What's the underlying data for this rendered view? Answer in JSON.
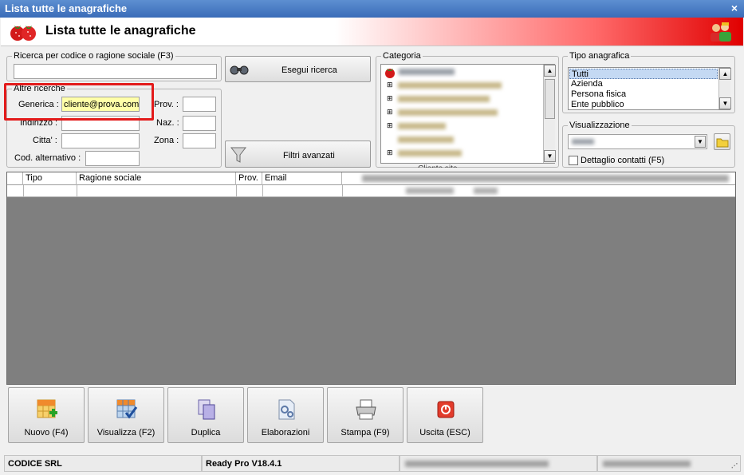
{
  "window": {
    "title": "Lista tutte le anagrafiche",
    "close_glyph": "×"
  },
  "banner": {
    "title": "Lista tutte le anagrafiche",
    "left_icon": "strawberry-icon",
    "right_icon": "users-icon"
  },
  "search": {
    "group_label": "Ricerca per codice o ragione sociale (F3)",
    "value": "",
    "run_button": "Esegui ricerca",
    "advanced_button": "Filtri avanzati"
  },
  "other": {
    "group_label": "Altre ricerche",
    "generica_label": "Generica :",
    "generica_value": "cliente@prova.com",
    "indirizzo_label": "Indirizzo :",
    "citta_label": "Citta' :",
    "cod_alt_label": "Cod. alternativo :",
    "prov_label": "Prov. :",
    "naz_label": "Naz. :",
    "zona_label": "Zona :"
  },
  "categoria": {
    "group_label": "Categoria",
    "last_item": "Cliente sito"
  },
  "tipo": {
    "group_label": "Tipo anagrafica",
    "options": [
      "Tutti",
      "Azienda",
      "Persona fisica",
      "Ente pubblico"
    ],
    "selected": "Tutti"
  },
  "visualizzazione": {
    "group_label": "Visualizzazione",
    "detail_label": "Dettaglio contatti (F5)",
    "detail_checked": false
  },
  "grid": {
    "columns": [
      "Tipo",
      "Ragione sociale",
      "Prov.",
      "Email"
    ]
  },
  "toolbar": {
    "new_label": "Nuovo (F4)",
    "view_label": "Visualizza (F2)",
    "dup_label": "Duplica",
    "elab_label": "Elaborazioni",
    "print_label": "Stampa (F9)",
    "exit_label": "Uscita (ESC)"
  },
  "status": {
    "company": "CODICE SRL",
    "version": "Ready Pro V18.4.1"
  },
  "colors": {
    "highlight_red": "#e31b1b",
    "selected_blue": "#c4d9f3",
    "input_yellow": "#ffffa8",
    "grid_gray": "#7f7f7f"
  }
}
